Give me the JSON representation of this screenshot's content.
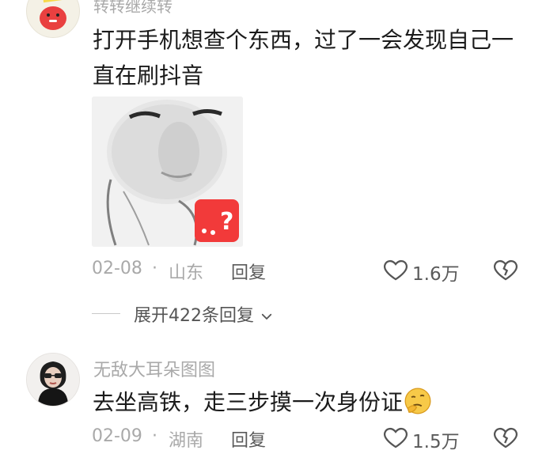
{
  "comments": [
    {
      "username": "转转继续转",
      "text": "打开手机想查个东西，过了一会发现自己一直在刷抖音",
      "date": "02-08",
      "location": "山东",
      "reply_label": "回复",
      "likes": "1.6万",
      "expand_label": "展开422条回复",
      "has_sticker": true
    },
    {
      "username": "无敌大耳朵图图",
      "text": "去坐高铁，走三步摸一次身份证",
      "date": "02-09",
      "location": "湖南",
      "reply_label": "回复",
      "likes": "1.5万"
    }
  ],
  "separator": "·",
  "icons": {
    "like": "heart-outline-icon",
    "dislike": "broken-heart-icon",
    "expand": "chevron-down-icon",
    "emoji": "thinking-face-emoji-icon"
  },
  "colors": {
    "text": "#1b1b1b",
    "meta": "#a9a9a9",
    "action": "#5a5a5a",
    "sticker_red": "#f23a3a"
  }
}
